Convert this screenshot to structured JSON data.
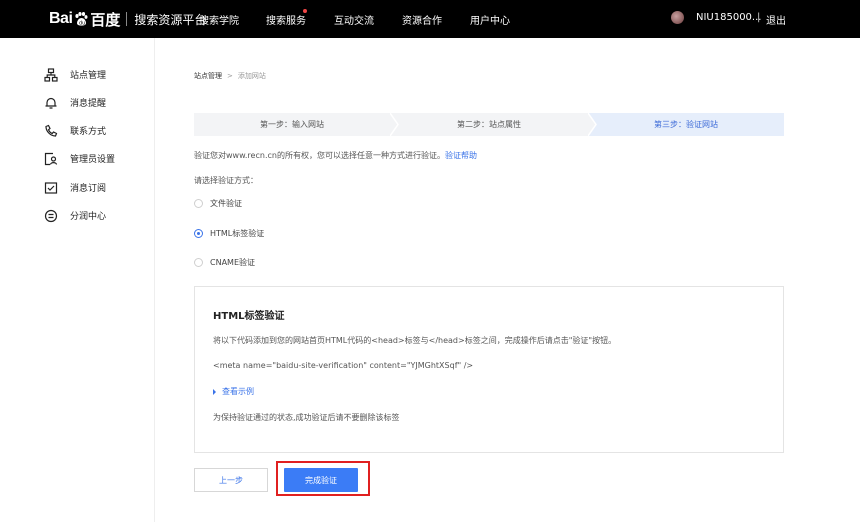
{
  "topbar": {
    "logo_bai": "Bai",
    "logo_baidu": "百度",
    "platform": "搜索资源平台",
    "nav": [
      {
        "label": "搜索学院"
      },
      {
        "label": "搜索服务"
      },
      {
        "label": "互动交流"
      },
      {
        "label": "资源合作"
      },
      {
        "label": "用户中心"
      }
    ],
    "user_name": "NIU185000...",
    "divider": "|",
    "logout": "退出",
    "dot_color": "#f04646"
  },
  "sidebar": {
    "items": [
      {
        "label": "站点管理",
        "icon": "sitemap-icon"
      },
      {
        "label": "消息提醒",
        "icon": "bell-icon"
      },
      {
        "label": "联系方式",
        "icon": "phone-icon"
      },
      {
        "label": "管理员设置",
        "icon": "admin-icon"
      },
      {
        "label": "消息订阅",
        "icon": "subscribe-icon"
      },
      {
        "label": "分润中心",
        "icon": "revenue-icon"
      }
    ]
  },
  "breadcrumb": {
    "parent": "站点管理",
    "separator": ">",
    "current": "添加网站"
  },
  "steps": [
    {
      "label": "第一步：输入网站",
      "active": false
    },
    {
      "label": "第二步：站点属性",
      "active": false
    },
    {
      "label": "第三步：验证网站",
      "active": true
    }
  ],
  "description": {
    "text": "验证您对www.recn.cn的所有权，您可以选择任意一种方式进行验证。",
    "help_link": "验证帮助"
  },
  "choose_label": "请选择验证方式：",
  "methods": [
    {
      "label": "文件验证",
      "selected": false
    },
    {
      "label": "HTML标签验证",
      "selected": true
    },
    {
      "label": "CNAME验证",
      "selected": false
    }
  ],
  "panel": {
    "title": "HTML标签验证",
    "instruction": "将以下代码添加到您的网站首页HTML代码的<head>标签与</head>标签之间，完成操作后请点击\"验证\"按钮。",
    "code": "<meta name=\"baidu-site-verification\" content=\"YJMGhtXSqf\" />",
    "example_link": "查看示例",
    "note": "为保持验证通过的状态,成功验证后请不要删除该标签"
  },
  "buttons": {
    "prev": "上一步",
    "done": "完成验证"
  },
  "colors": {
    "accent": "#3a73e8",
    "primary_button": "#3b7cf6",
    "highlight": "#e02020"
  }
}
